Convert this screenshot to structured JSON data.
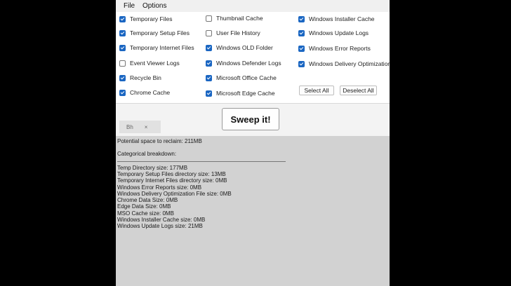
{
  "menu": {
    "file": "File",
    "options": "Options"
  },
  "options": {
    "col1": [
      {
        "label": "Temporary Files",
        "checked": true
      },
      {
        "label": "Temporary Setup Files",
        "checked": true
      },
      {
        "label": "Temporary Internet Files",
        "checked": true
      },
      {
        "label": "Event Viewer Logs",
        "checked": false
      },
      {
        "label": "Recycle Bin",
        "checked": true
      },
      {
        "label": "Chrome Cache",
        "checked": true
      }
    ],
    "col2": [
      {
        "label": "Thumbnail Cache",
        "checked": false
      },
      {
        "label": "User File History",
        "checked": false
      },
      {
        "label": "Windows OLD Folder",
        "checked": true
      },
      {
        "label": "Windows Defender Logs",
        "checked": true
      },
      {
        "label": "Microsoft Office Cache",
        "checked": true
      },
      {
        "label": "Microsoft Edge Cache",
        "checked": true
      }
    ],
    "col3": [
      {
        "label": "Windows Installer Cache",
        "checked": true
      },
      {
        "label": "Windows Update Logs",
        "checked": true
      },
      {
        "label": "Windows Error Reports",
        "checked": true
      },
      {
        "label": "Windows Delivery Optimization",
        "checked": true
      }
    ],
    "select_all": "Select All",
    "deselect_all": "Deselect All"
  },
  "action": {
    "sweep_label": "Sweep it!",
    "tab_chip": {
      "label": "Bh",
      "close": "×"
    }
  },
  "output": {
    "potential": "Potential space to reclaim: 211MB",
    "breakdown_heading": "Categorical breakdown:",
    "lines": [
      "Temp Directory size: 177MB",
      "Temporary Setup Files directory size: 13MB",
      "Temporary Internet Files directory size: 0MB",
      "Windows Error Reports size: 0MB",
      "Windows Delivery Optimization File size: 0MB",
      "Chrome Data Size: 0MB",
      "Edge Data Size: 0MB",
      "MSO Cache size: 0MB",
      "Windows Installer Cache size: 0MB",
      "Windows Update Logs size: 21MB"
    ]
  },
  "colors": {
    "accent": "#1a66c2",
    "output_bg": "#d2d2d2",
    "panel_bg": "#ffffff"
  }
}
